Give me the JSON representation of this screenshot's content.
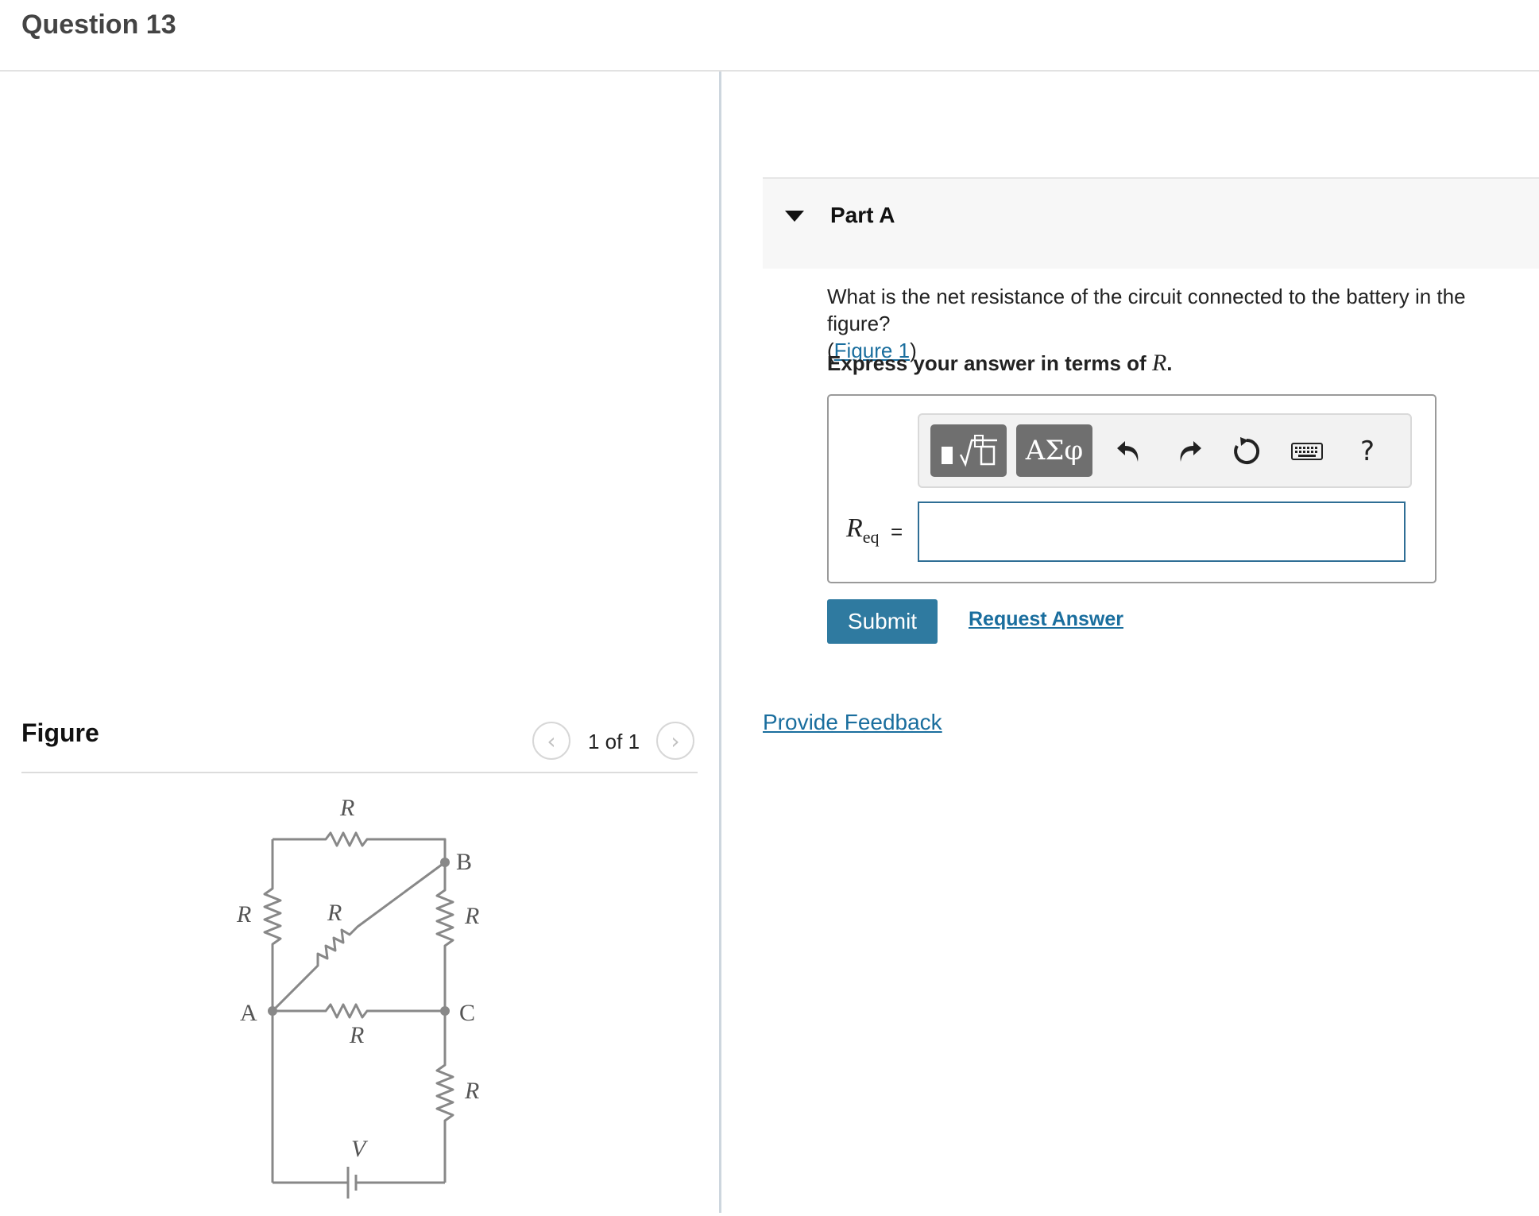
{
  "header": {
    "title": "Question 13"
  },
  "figure_panel": {
    "title": "Figure",
    "counter": "1 of 1",
    "prev_icon": "chevron-left-icon",
    "next_icon": "chevron-right-icon",
    "circuit_labels": {
      "r_top": "R",
      "r_left": "R",
      "r_diag": "R",
      "r_right_upper": "R",
      "r_middle": "R",
      "r_right_lower": "R",
      "node_a": "A",
      "node_b": "B",
      "node_c": "C",
      "battery": "V"
    }
  },
  "part": {
    "label": "Part A",
    "question": "What is the net resistance of the circuit connected to the battery in the figure?",
    "figure_link": "Figure 1",
    "instruction_prefix": "Express your answer in terms of ",
    "instruction_var": "R",
    "instruction_suffix": "."
  },
  "answer": {
    "label_var": "R",
    "label_sub": "eq",
    "equals": "=",
    "input_value": "",
    "toolbar": {
      "greek_label": "ΑΣφ",
      "icons": [
        "templates-icon",
        "greek-icon",
        "undo-icon",
        "redo-icon",
        "reset-icon",
        "keyboard-icon",
        "help-icon"
      ],
      "help_label": "?"
    }
  },
  "actions": {
    "submit_label": "Submit",
    "request_answer_label": "Request Answer",
    "feedback_label": "Provide Feedback"
  },
  "colors": {
    "link": "#1a6e9e",
    "submit_bg": "#2f7aa0",
    "toolbar_button_bg": "#6f6f6f",
    "input_border": "#2f6e95"
  }
}
